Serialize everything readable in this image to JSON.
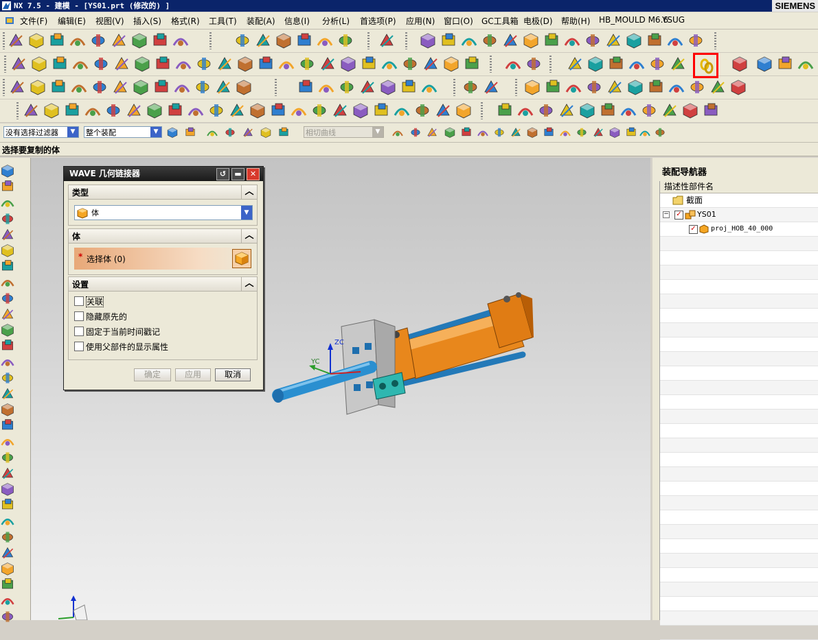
{
  "window": {
    "title": "NX 7.5 - 建模 - [YS01.prt (修改的) ]",
    "brand": "SIEMENS"
  },
  "menu": [
    "文件(F)",
    "编辑(E)",
    "视图(V)",
    "插入(S)",
    "格式(R)",
    "工具(T)",
    "装配(A)",
    "信息(I)",
    "分析(L)",
    "首选项(P)",
    "应用(N)",
    "窗口(O)",
    "GC工具箱",
    "电极(D)",
    "帮助(H)",
    "HB_MOULD M6.6",
    "YSUG"
  ],
  "selection_bar": {
    "filter_value": "没有选择过滤器",
    "scope_value": "整个装配",
    "curve_rule_value": "相切曲线"
  },
  "status": {
    "prompt": "选择要复制的体"
  },
  "dialog": {
    "title": "WAVE 几何链接器",
    "section_type": "类型",
    "type_value": "体",
    "section_body": "体",
    "select_body_label": "选择体 (0)",
    "required_mark": "*",
    "section_settings": "设置",
    "options": [
      "关联",
      "隐藏原先的",
      "固定于当前时间戳记",
      "使用父部件的显示属性"
    ],
    "ok_label": "确定",
    "apply_label": "应用",
    "cancel_label": "取消"
  },
  "navigator": {
    "title": "装配导航器",
    "column_header": "描述性部件名",
    "nodes": [
      {
        "label": "截面",
        "indent": 0,
        "type": "folder"
      },
      {
        "label": "YS01",
        "indent": 0,
        "type": "assembly"
      },
      {
        "label": "proj_HOB_40_000",
        "indent": 1,
        "type": "part"
      }
    ]
  },
  "triad": {
    "xc": "XC",
    "yc": "YC",
    "zc": "ZC"
  },
  "colors": {
    "accent_highlight": "#ff0000",
    "part_blue": "#2a8fd0",
    "part_orange": "#e8871c",
    "plate_gray": "#c8c8c8",
    "teal_block": "#2fb7b0"
  }
}
